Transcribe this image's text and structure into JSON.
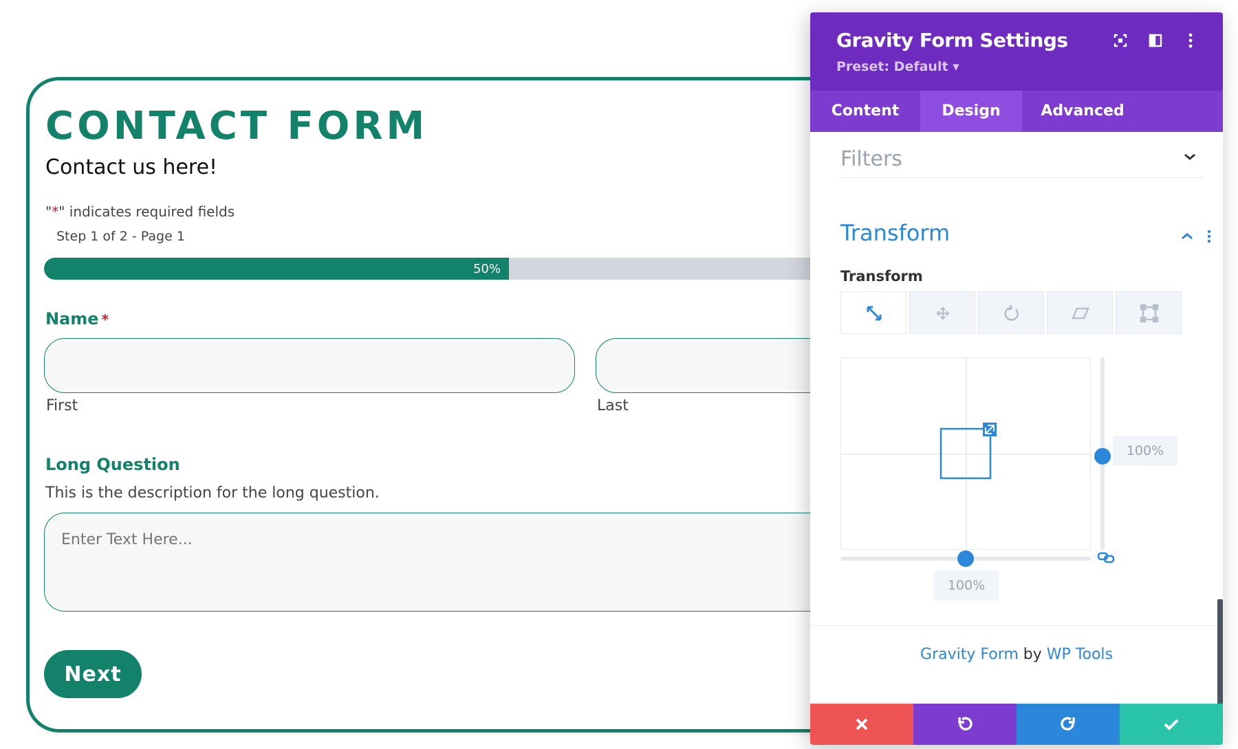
{
  "form": {
    "title": "CONTACT FORM",
    "subtitle": "Contact us here!",
    "required_note_quote_open": "\"",
    "required_note_star": "*",
    "required_note_rest": "\" indicates required fields",
    "step_text": "Step 1 of 2 - Page 1",
    "progress": {
      "value_fraction": 0.5,
      "label": "50%"
    },
    "name_label": "Name",
    "required_star": "*",
    "first_label": "First",
    "last_label": "Last",
    "long_question_label": "Long Question",
    "long_question_desc": "This is the description for the long question.",
    "long_question_placeholder": "Enter Text Here...",
    "next_button": "Next"
  },
  "panel": {
    "title": "Gravity Form Settings",
    "preset": "Preset: Default ▾",
    "header_icons": [
      "fullscreen-icon",
      "split-view-icon",
      "more-options-icon"
    ],
    "tabs": [
      {
        "label": "Content",
        "active": false
      },
      {
        "label": "Design",
        "active": true
      },
      {
        "label": "Advanced",
        "active": false
      }
    ],
    "filters_label": "Filters",
    "transform_title": "Transform",
    "transform_sublabel": "Transform",
    "transform_tools": [
      "scale-icon",
      "translate-icon",
      "rotate-icon",
      "skew-icon",
      "origin-icon"
    ],
    "scale_y": "100%",
    "scale_x": "100%",
    "credit": {
      "plugin": "Gravity Form",
      "by": " by ",
      "author": "WP Tools"
    },
    "actions": [
      "cancel-icon",
      "undo-icon",
      "redo-icon",
      "save-icon"
    ]
  },
  "colors": {
    "brand_green": "#12836a",
    "panel_purple": "#6d2cbf",
    "tab_purple": "#7e3bd0",
    "accent_blue": "#2b87da",
    "cancel_red": "#ef5454",
    "undo_purple": "#7e3bd0",
    "redo_blue": "#2b87da",
    "save_green": "#29c4a9"
  }
}
